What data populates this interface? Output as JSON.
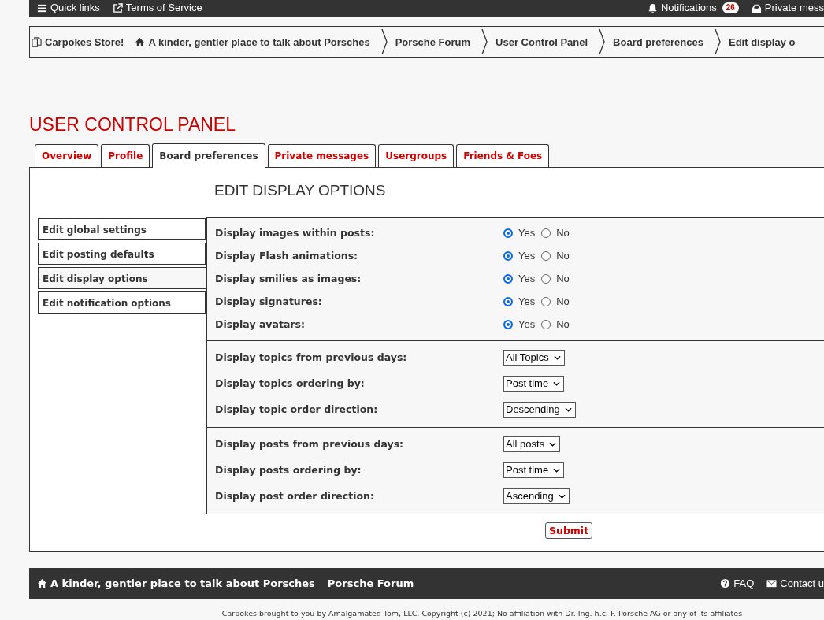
{
  "top_bar": {
    "left": [
      {
        "label": "Quick links"
      },
      {
        "label": "Terms of Service"
      }
    ],
    "right": [
      {
        "label": "Notifications",
        "badge": "26"
      },
      {
        "label": "Private mess"
      }
    ]
  },
  "breadcrumbs": [
    {
      "label": "Carpokes Store!"
    },
    {
      "label": "A kinder, gentler place to talk about Porsches"
    },
    {
      "label": "Porsche Forum"
    },
    {
      "label": "User Control Panel"
    },
    {
      "label": "Board preferences"
    },
    {
      "label": "Edit display o"
    }
  ],
  "page_title": "USER CONTROL PANEL",
  "tabs": [
    {
      "label": "Overview",
      "selected": false
    },
    {
      "label": "Profile",
      "selected": false
    },
    {
      "label": "Board preferences",
      "selected": true
    },
    {
      "label": "Private messages",
      "selected": false
    },
    {
      "label": "Usergroups",
      "selected": false
    },
    {
      "label": "Friends & Foes",
      "selected": false
    }
  ],
  "sidebar": {
    "items": [
      {
        "label": "Edit global settings",
        "selected": false
      },
      {
        "label": "Edit posting defaults",
        "selected": false
      },
      {
        "label": "Edit display options",
        "selected": true
      },
      {
        "label": "Edit notification options",
        "selected": false
      }
    ]
  },
  "heading": "EDIT DISPLAY OPTIONS",
  "sections": [
    {
      "rows": [
        {
          "kind": "radio",
          "label": "Display images within posts:",
          "options": [
            {
              "label": "Yes",
              "selected": true
            },
            {
              "label": "No",
              "selected": false
            }
          ]
        },
        {
          "kind": "radio",
          "label": "Display Flash animations:",
          "options": [
            {
              "label": "Yes",
              "selected": true
            },
            {
              "label": "No",
              "selected": false
            }
          ]
        },
        {
          "kind": "radio",
          "label": "Display smilies as images:",
          "options": [
            {
              "label": "Yes",
              "selected": true
            },
            {
              "label": "No",
              "selected": false
            }
          ]
        },
        {
          "kind": "radio",
          "label": "Display signatures:",
          "options": [
            {
              "label": "Yes",
              "selected": true
            },
            {
              "label": "No",
              "selected": false
            }
          ]
        },
        {
          "kind": "radio",
          "label": "Display avatars:",
          "options": [
            {
              "label": "Yes",
              "selected": true
            },
            {
              "label": "No",
              "selected": false
            }
          ]
        }
      ]
    },
    {
      "rows": [
        {
          "kind": "select",
          "label": "Display topics from previous days:",
          "value": "All Topics"
        },
        {
          "kind": "select",
          "label": "Display topics ordering by:",
          "value": "Post time"
        },
        {
          "kind": "select",
          "label": "Display topic order direction:",
          "value": "Descending"
        }
      ]
    },
    {
      "rows": [
        {
          "kind": "select",
          "label": "Display posts from previous days:",
          "value": "All posts"
        },
        {
          "kind": "select",
          "label": "Display posts ordering by:",
          "value": "Post time"
        },
        {
          "kind": "select",
          "label": "Display post order direction:",
          "value": "Ascending"
        }
      ]
    }
  ],
  "submit": "Submit",
  "footer": {
    "left": [
      {
        "label": "A kinder, gentler place to talk about Porsches"
      },
      {
        "label": "Porsche Forum"
      }
    ],
    "right": [
      {
        "label": "FAQ"
      },
      {
        "label": "Contact u"
      }
    ]
  },
  "copyright": "Carpokes brought to you by Amalgamated Tom, LLC, Copyright (c) 2021; No affiliation with Dr. Ing. h.c. F. Porsche AG or any of its affiliates"
}
